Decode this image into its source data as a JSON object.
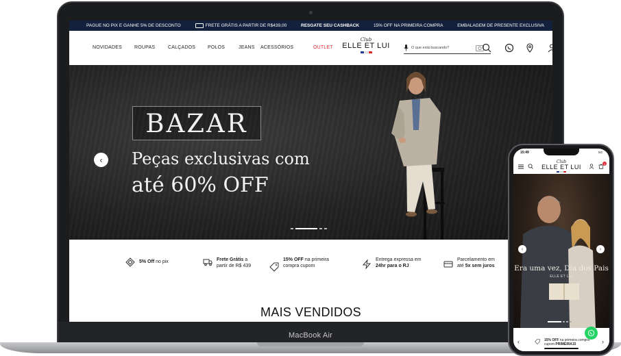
{
  "device": {
    "laptop_label": "MacBook Air"
  },
  "desktop": {
    "promo_bar": [
      {
        "text": "PAGUE NO PIX E GANHE 5% DE DESCONTO"
      },
      {
        "text": "FRETE GRÁTIS A PARTIR DE R$439,00",
        "icon": "truck-icon"
      },
      {
        "text": "RESGATE SEU CASHBACK",
        "bold": true
      },
      {
        "text": "15% OFF NA PRIMEIRA COMPRA"
      },
      {
        "text": "EMBALAGEM DE PRESENTE EXCLUSIVA"
      }
    ],
    "nav": {
      "items": [
        "NOVIDADES",
        "ROUPAS",
        "CALÇADOS",
        "POLOS",
        "JEANS",
        "ACESSÓRIOS",
        "OUTLET"
      ],
      "logo": {
        "club": "Club",
        "name": "ELLE ET LUI"
      },
      "search_placeholder": "O que está buscando?",
      "icons": [
        "microphone-icon",
        "camera-search-icon",
        "search-icon",
        "whatsapp-icon",
        "location-pin-icon",
        "user-icon"
      ]
    },
    "hero": {
      "badge": "BAZAR",
      "line1": "Peças exclusivas com",
      "line2": "até 60% OFF",
      "slide_count": 4,
      "active_slide": 1
    },
    "benefits": [
      {
        "icon": "pix-icon",
        "bold": "5% Off",
        "rest": " no pix"
      },
      {
        "icon": "truck-icon",
        "bold": "Frete Grátis",
        "rest": " a partir de R$ 439"
      },
      {
        "icon": "tag-icon",
        "bold": "15% OFF",
        "rest": " na primeira compra cupom PRIMEIRA15"
      },
      {
        "icon": "lightning-icon",
        "pre": "Entrega expressa em ",
        "bold": "24hr para o RJ"
      },
      {
        "icon": "card-icon",
        "pre": "Parcelamento em até ",
        "bold": "5x sem juros"
      }
    ],
    "section_title": "MAIS VENDIDOS"
  },
  "mobile": {
    "time": "15:49",
    "status": "5G",
    "logo": {
      "club": "Club",
      "name": "ELLE ET LUI"
    },
    "cart_count": "1",
    "hero": {
      "title": "Era uma vez, Dia dos Pais",
      "brand": "ELLE ET LUI"
    },
    "benefit": {
      "bold": "15% OFF",
      "rest": " na primeira compra",
      "line2_pre": "cupom ",
      "line2_bold": "PRIMEIRA15"
    }
  },
  "colors": {
    "promo_bg": "#14213d",
    "outlet": "#e0303a",
    "whatsapp": "#25d366"
  }
}
